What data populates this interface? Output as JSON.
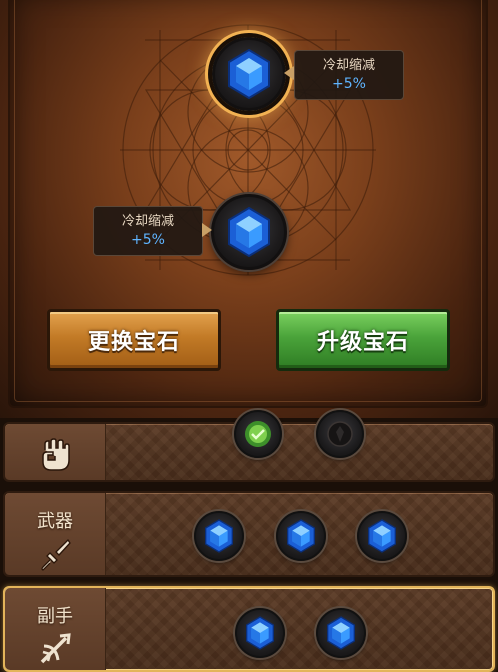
{
  "gem_panel": {
    "slot_top": {
      "tooltip_title": "冷却缩减",
      "tooltip_value": "+5%",
      "gem": "blue-hexagon-gem"
    },
    "slot_left": {
      "tooltip_title": "冷却缩减",
      "tooltip_value": "+5%",
      "gem": "blue-hexagon-gem"
    }
  },
  "buttons": {
    "replace_label": "更换宝石",
    "upgrade_label": "升级宝石",
    "replace_color": "#c27a26",
    "upgrade_color": "#4aa33a"
  },
  "equipment_rows": [
    {
      "name": "",
      "icon": "fist-icon",
      "gems": [
        "green-gem",
        "dark-empty-gem"
      ],
      "partial": true
    },
    {
      "name": "武器",
      "icon": "sword-icon",
      "gems": [
        "blue-hexagon-gem",
        "blue-hexagon-gem",
        "blue-hexagon-gem"
      ]
    },
    {
      "name": "副手",
      "icon": "crossbow-icon",
      "gems": [
        "blue-hexagon-gem",
        "blue-hexagon-gem"
      ],
      "selected": true
    }
  ],
  "colors": {
    "gem_blue": "#2f8cff",
    "highlight_gold": "#f2b253",
    "value_blue": "#5fb4ff"
  }
}
